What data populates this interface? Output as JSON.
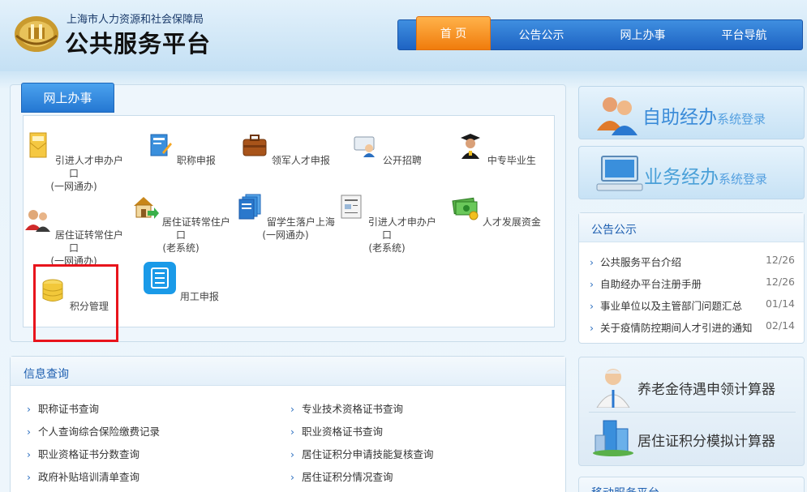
{
  "header": {
    "subtitle": "上海市人力资源和社会保障局",
    "title": "公共服务平台"
  },
  "nav": {
    "items": [
      "首 页",
      "公告公示",
      "网上办事",
      "平台导航"
    ]
  },
  "online": {
    "tab": "网上办事",
    "services": [
      {
        "icon": "document-envelope-icon",
        "l1": "引进人才申办户口",
        "l2": "(一网通办)"
      },
      {
        "icon": "certificate-edit-icon",
        "l1": "职称申报",
        "l2": ""
      },
      {
        "icon": "briefcase-icon",
        "l1": "领军人才申报",
        "l2": ""
      },
      {
        "icon": "recruitment-card-icon",
        "l1": "公开招聘",
        "l2": ""
      },
      {
        "icon": "graduate-icon",
        "l1": "中专毕业生",
        "l2": ""
      },
      {
        "icon": "couple-users-icon",
        "l1": "居住证转常住户口",
        "l2": "(一网通办)"
      },
      {
        "icon": "house-arrow-icon",
        "l1": "居住证转常住户口",
        "l2": "(老系统)"
      },
      {
        "icon": "documents-stack-icon",
        "l1": "留学生落户上海",
        "l2": "(一网通办)"
      },
      {
        "icon": "form-document-icon",
        "l1": "引进人才申办户口",
        "l2": "(老系统)"
      },
      {
        "icon": "money-icon",
        "l1": "人才发展资金",
        "l2": ""
      },
      {
        "icon": "database-coins-icon",
        "l1": "积分管理",
        "l2": ""
      },
      {
        "icon": "list-app-icon",
        "l1": "用工申报",
        "l2": ""
      }
    ]
  },
  "info": {
    "title": "信息查询",
    "left": [
      "职称证书查询",
      "个人查询综合保险缴费记录",
      "职业资格证书分数查询",
      "政府补贴培训清单查询"
    ],
    "right": [
      "专业技术资格证书查询",
      "职业资格证书查询",
      "居住证积分申请技能复核查询",
      "居住证积分情况查询"
    ]
  },
  "side": {
    "banner1_big": "自助经办",
    "banner1_small": "系统登录",
    "banner2_big": "业务经办",
    "banner2_small": "系统登录"
  },
  "notice": {
    "title": "公告公示",
    "items": [
      {
        "text": "公共服务平台介绍",
        "date": "12/26"
      },
      {
        "text": "自助经办平台注册手册",
        "date": "12/26"
      },
      {
        "text": "事业单位以及主管部门问题汇总",
        "date": "01/14"
      },
      {
        "text": "关于疫情防控期间人才引进的通知",
        "date": "02/14"
      }
    ]
  },
  "calc": {
    "pension": "养老金待遇申领计算器",
    "points": "居住证积分模拟计算器"
  },
  "mobile": {
    "title": "移动服务平台"
  }
}
